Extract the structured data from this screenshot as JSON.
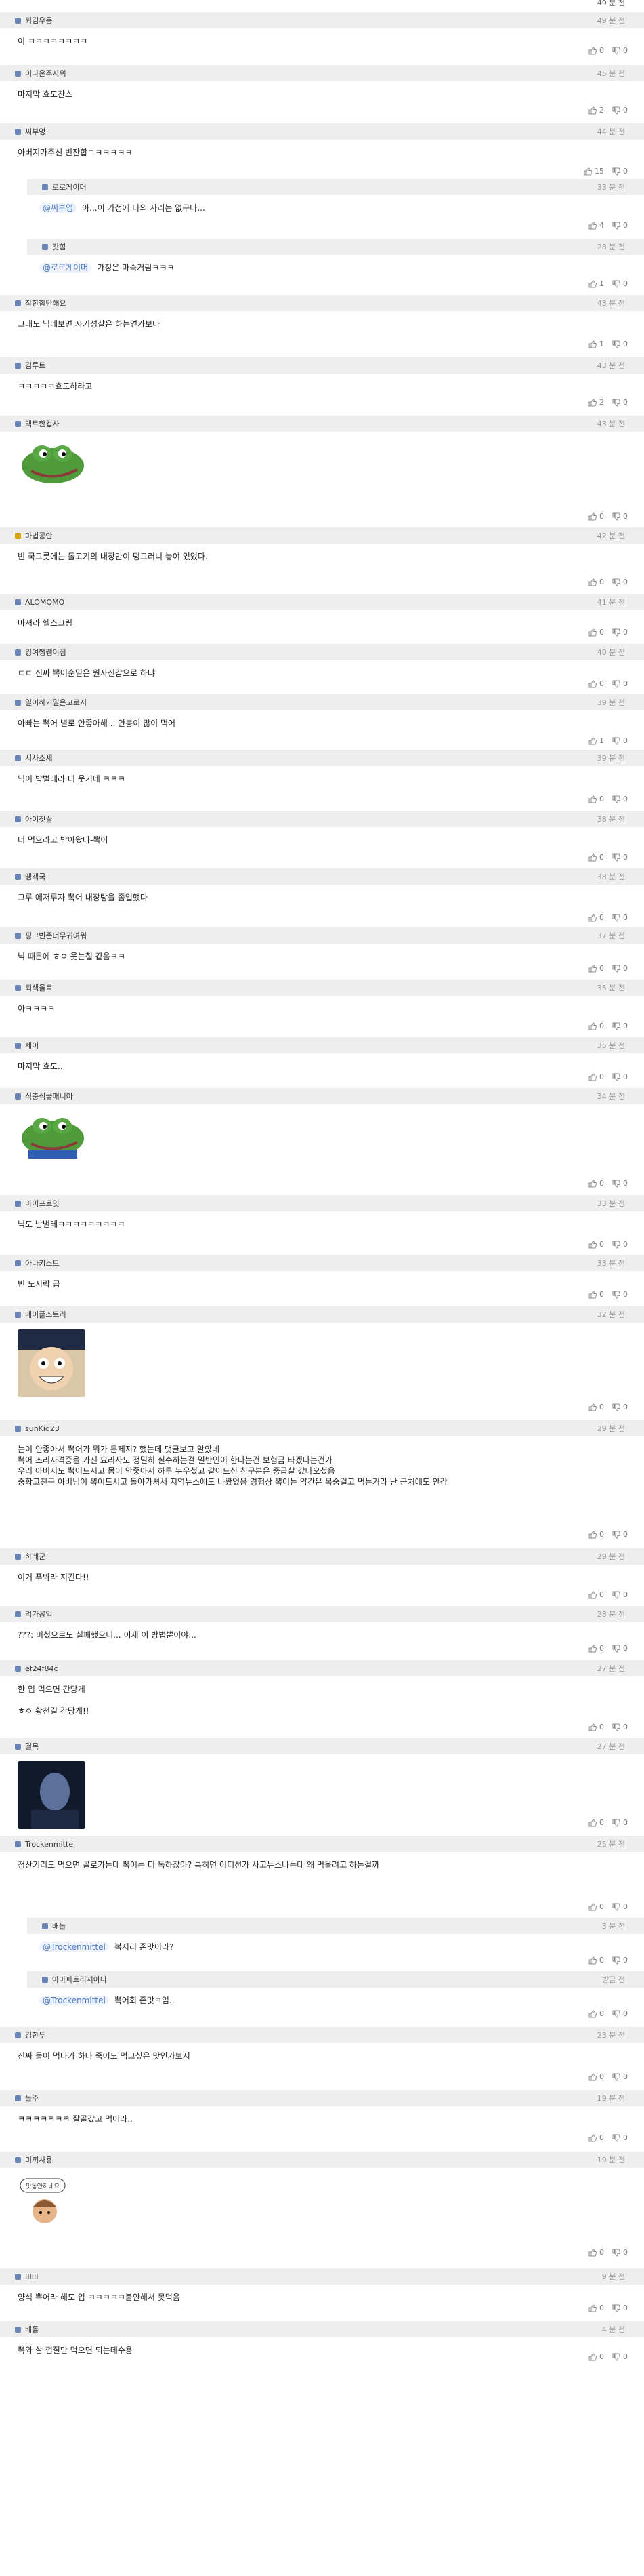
{
  "top_time": "49 분 전",
  "comments": [
    {
      "nick": "퇴김우동",
      "time": "49 분 전",
      "text": "이 ㅋㅋㅋㅋㅋㅋㅋㅋ",
      "up": "0",
      "down": "0"
    },
    {
      "nick": "이나온주사위",
      "time": "45 분 전",
      "text": "마지막 효도찬스",
      "up": "2",
      "down": "0"
    },
    {
      "nick": "씨부엉",
      "time": "44 분 전",
      "text": "아버지가주신 빈잔합ㄱㅋㅋㅋㅋㅋ",
      "up": "15",
      "down": "0"
    },
    {
      "nick": "로로게이머",
      "time": "33 분 전",
      "mention": "@씨부엉",
      "text": "아...이 가정에 나의 자리는 없구나...",
      "up": "4",
      "down": "0",
      "reply": true
    },
    {
      "nick": "갓힘",
      "time": "28 분 전",
      "mention": "@로로게이머",
      "text": "가정은 마슥거림ㅋㅋㅋ",
      "up": "1",
      "down": "0",
      "reply": true
    },
    {
      "nick": "착한함만해요",
      "time": "43 분 전",
      "text": "그래도 닉네보면 자기성찰은 하는연가보다",
      "up": "1",
      "down": "0"
    },
    {
      "nick": "김루트",
      "time": "43 분 전",
      "text": "ㅋㅋㅋㅋㅋ효도하라고",
      "up": "2",
      "down": "0"
    },
    {
      "nick": "맥트한컵사",
      "time": "43 분 전",
      "text": "",
      "image": "frog",
      "up": "0",
      "down": "0"
    },
    {
      "nick": "마법공안",
      "time": "42 분 전",
      "text": "빈 국그릇에는 돌고기의 내장만이 덩그러니 놓여 있었다.",
      "up": "0",
      "down": "0",
      "gold": true
    },
    {
      "nick": "ALOMOMO",
      "time": "41 분 전",
      "text": "마셔라 헬스크림",
      "up": "0",
      "down": "0"
    },
    {
      "nick": "잉여쨍쨍이짐",
      "time": "40 분 전",
      "text": "ㄷㄷ 진짜 뽁어순밑은 원자신감으로 하냐",
      "up": "0",
      "down": "0"
    },
    {
      "nick": "일이하기일은고로시",
      "time": "39 분 전",
      "text": "아빠는 뽁어 별로 안좋아해 .. 안봉이 많이 먹어",
      "up": "1",
      "down": "0"
    },
    {
      "nick": "시사소세",
      "time": "39 분 전",
      "text": "닉이 밥벌레라 더 웃기네 ㅋㅋㅋ",
      "up": "0",
      "down": "0"
    },
    {
      "nick": "아이짓꿀",
      "time": "38 분 전",
      "text": "너 먹으라고 받아왔다-뽁어",
      "up": "0",
      "down": "0"
    },
    {
      "nick": "땡객국",
      "time": "38 분 전",
      "text": "그루 에저루자 뽁어 내장탕을 좀입했다",
      "up": "0",
      "down": "0"
    },
    {
      "nick": "핑크빈준너무귀여워",
      "time": "37 분 전",
      "text": "닉 때문에 ㅎㅇ 웃는칠 같음ㅋㅋ",
      "up": "0",
      "down": "0"
    },
    {
      "nick": "퇴색울료",
      "time": "35 분 전",
      "text": "아ㅋㅋㅋㅋ",
      "up": "0",
      "down": "0"
    },
    {
      "nick": "세이",
      "time": "35 분 전",
      "text": "마지막 효도..",
      "up": "0",
      "down": "0"
    },
    {
      "nick": "식충식물매니아",
      "time": "34 분 전",
      "text": "",
      "image": "frog2",
      "up": "0",
      "down": "0"
    },
    {
      "nick": "마이프로잇",
      "time": "33 분 전",
      "text": "닉도 밥벌레ㅋㅋㅋㅋㅋㅋㅋㅋㅋ",
      "up": "0",
      "down": "0"
    },
    {
      "nick": "아나키스트",
      "time": "33 분 전",
      "text": "빈 도시락 급",
      "up": "0",
      "down": "0"
    },
    {
      "nick": "메이플스토리",
      "time": "32 분 전",
      "text": "",
      "image": "face",
      "up": "0",
      "down": "0"
    },
    {
      "nick": "sunKid23",
      "time": "29 분 전",
      "text": "",
      "lines": [
        "는이 안좋아서 뽁어가 뭐가 문제지? 했는데 댓글보고 알았네",
        "뽁어 조리자격증을 가진 요리사도 정밀히 실수하는걸 일반인이 한다는건 보험금 타겠다는건가",
        "우리 아버지도 뽁어드시고 몸이 안좋아서 하루 누우셨고 같이드신 친구분은 중급살 갔다오셨음",
        "중학교친구 아버님이 뽁어드시고 돌아가셔서 지역뉴스에도 나왔었음 경험상 뽁어는 약간은 목숨걸고 먹는거라 난 근처에도 안감"
      ],
      "up": "0",
      "down": "0"
    },
    {
      "nick": "하레군",
      "time": "29 분 전",
      "text": "이거 푸봐라 지긴다!!",
      "up": "0",
      "down": "0"
    },
    {
      "nick": "먹가공익",
      "time": "28 분 전",
      "text": "???: 비셨으로도 실패했으니... 이제 이 방법뿐이야...",
      "up": "0",
      "down": "0"
    },
    {
      "nick": "ef24f84c",
      "time": "27 분 전",
      "text": "",
      "lines": [
        "한 입 먹으면 간당게",
        "",
        "ㅎㅇ 황천길 간당게!!"
      ],
      "up": "0",
      "down": "0"
    },
    {
      "nick": "결목",
      "time": "27 분 전",
      "text": "",
      "image": "dark",
      "up": "0",
      "down": "0"
    },
    {
      "nick": "Trockenmittel",
      "time": "25 분 전",
      "text": "정산기리도 먹으면 골로가는데 뽁어는 더 독하잖아? 특히면 어디선가 사고뉴스나는데 왜 먹을려고 하는걸까",
      "up": "0",
      "down": "0"
    },
    {
      "nick": "배돌",
      "time": "3 분 전",
      "mention": "@Trockenmittel",
      "text": "복지리 존맛이라?",
      "up": "0",
      "down": "0",
      "reply": true
    },
    {
      "nick": "아마파트리지아나",
      "time": "방금 전",
      "mention": "@Trockenmittel",
      "text": "뽁어회 존맛ㅋ임..",
      "up": "0",
      "down": "0",
      "reply": true
    },
    {
      "nick": "김한두",
      "time": "23 분 전",
      "text": "진짜 돌이 먹다가 하나 죽어도 먹고싶은 맛인가보지",
      "up": "0",
      "down": "0"
    },
    {
      "nick": "돌주",
      "time": "19 분 전",
      "text": "ㅋㅋㅋㅋㅋㅋㅋ 잘골갔고 먹어라..",
      "up": "0",
      "down": "0"
    },
    {
      "nick": "미끼사용",
      "time": "19 분 전",
      "text": "",
      "image": "sticker",
      "up": "0",
      "down": "0"
    },
    {
      "nick": "IIIIII",
      "time": "9 분 전",
      "text": "양식 뽁어라 해도 입 ㅋㅋㅋㅋㅋ불안해서 못먹음",
      "up": "0",
      "down": "0"
    },
    {
      "nick": "배돌",
      "time": "4 분 전",
      "text": "뽁와 살 껍질만 먹으면 되는데수용",
      "up": "0",
      "down": "0"
    }
  ],
  "sticker_text": "맛동안하네요",
  "colors": {
    "header_bg": "#eeeeee",
    "mention": "#4a78c4",
    "badge_blue": "#6b86b6",
    "badge_gold": "#d4a400"
  },
  "icons": {
    "up": "thumb-up-icon",
    "down": "thumb-down-icon"
  }
}
